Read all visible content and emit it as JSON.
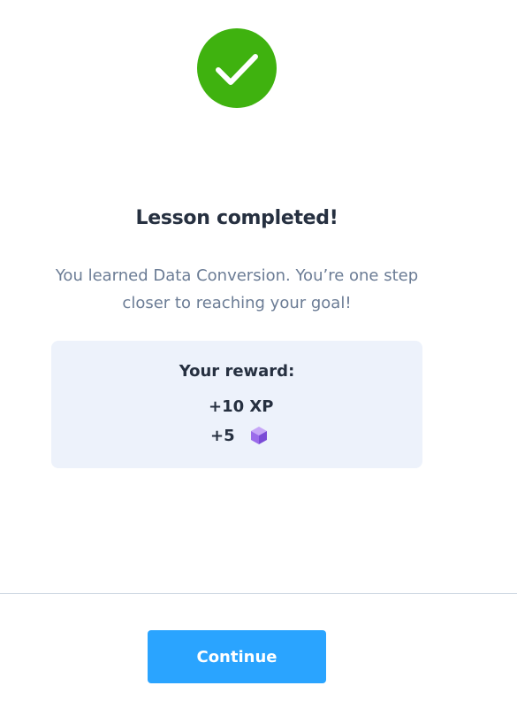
{
  "status": {
    "icon": "check-circle-icon",
    "color": "#3fb20f"
  },
  "title": "Lesson completed!",
  "subtitle": "You learned Data Conversion. You’re one step closer to reaching your goal!",
  "reward": {
    "heading": "Your reward:",
    "xp": "+10 XP",
    "gems": "+5",
    "gem_icon": "gem-cube-icon",
    "background": "#edf2fb"
  },
  "footer": {
    "continue_label": "Continue",
    "button_color": "#2aa4ff"
  }
}
